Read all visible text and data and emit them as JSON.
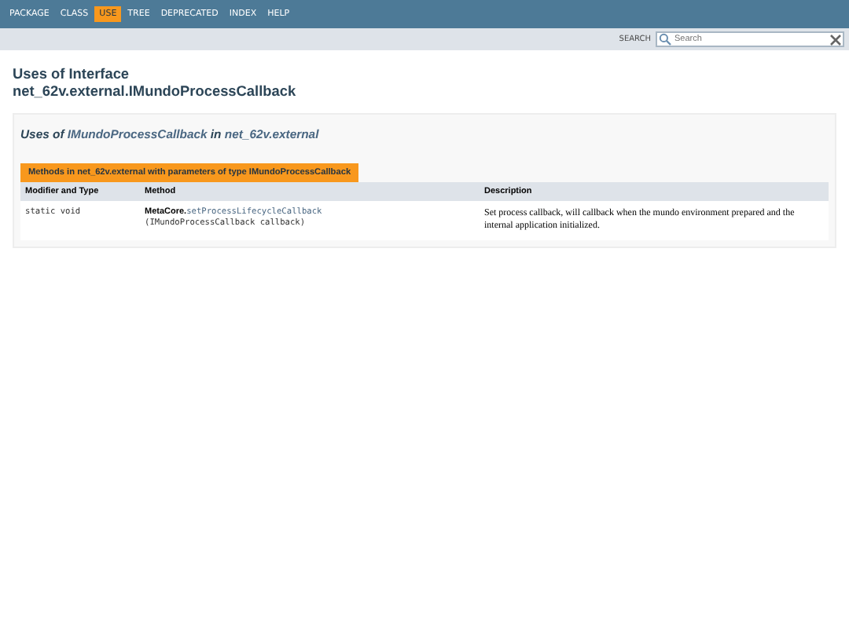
{
  "nav": [
    {
      "label": "PACKAGE",
      "selected": false
    },
    {
      "label": "CLASS",
      "selected": false
    },
    {
      "label": "USE",
      "selected": true
    },
    {
      "label": "TREE",
      "selected": false
    },
    {
      "label": "DEPRECATED",
      "selected": false
    },
    {
      "label": "INDEX",
      "selected": false
    },
    {
      "label": "HELP",
      "selected": false
    }
  ],
  "search": {
    "label": "SEARCH",
    "placeholder": "Search"
  },
  "title": {
    "line_1": "Uses of Interface",
    "line_2": "net_62v.external.IMundoProcessCallback"
  },
  "section": {
    "heading": {
      "prefix": "Uses of",
      "type_link": "IMundoProcessCallback",
      "middle": "in",
      "package_link": "net_62v.external"
    },
    "caption": "Methods in net_62v.external with parameters of type IMundoProcessCallback",
    "table": {
      "columns": [
        "Modifier and Type",
        "Method",
        "Description"
      ],
      "rows": [
        {
          "modifier": "static void",
          "class_name": "MetaCore.",
          "method": "setProcessLifecycleCallback",
          "params": "(IMundoProcessCallback callback)",
          "description": "Set process callback, will callback when the mundo environment prepared and the internal application initialized."
        }
      ]
    }
  }
}
